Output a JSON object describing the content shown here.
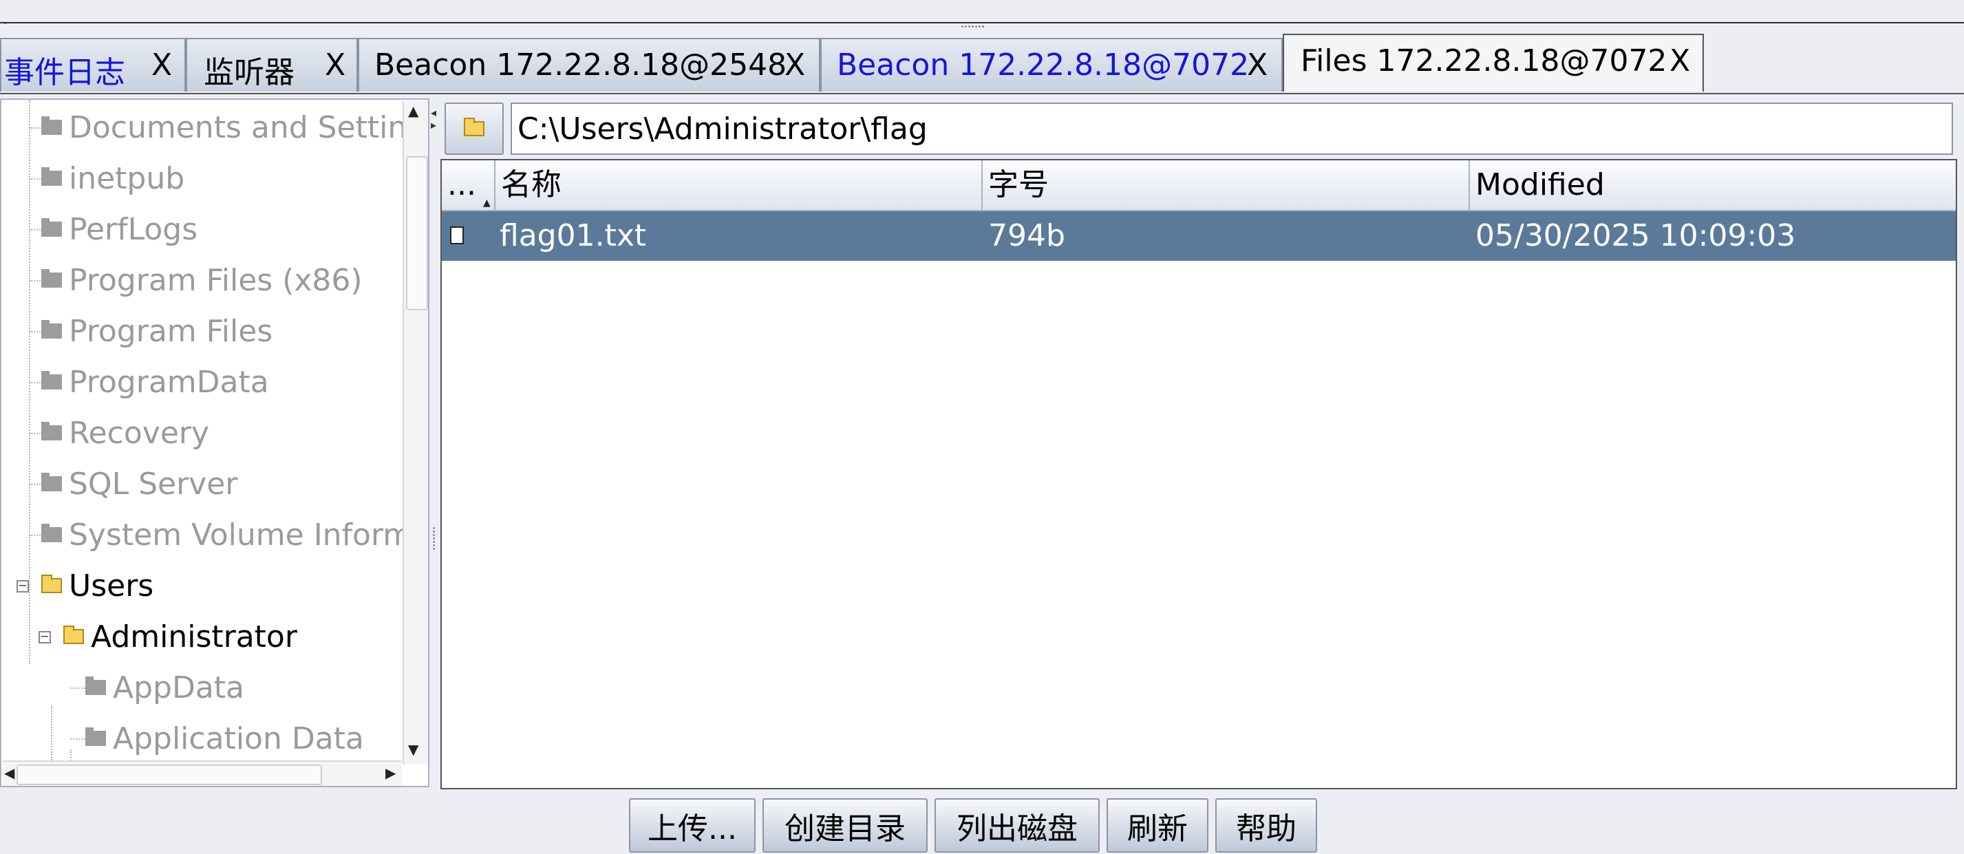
{
  "tabs": [
    {
      "label": "事件日志",
      "close": "X",
      "color": "#1414e0"
    },
    {
      "label": "监听器",
      "close": "X"
    },
    {
      "label": "Beacon 172.22.8.18@2548",
      "close": "X"
    },
    {
      "label": "Beacon 172.22.8.18@7072",
      "close": "X",
      "color": "#1414e0"
    },
    {
      "label": "Files 172.22.8.18@7072",
      "close": "X",
      "active": true
    }
  ],
  "tree": {
    "items": [
      {
        "label": "Documents and Settings",
        "expanded": false
      },
      {
        "label": "inetpub",
        "expanded": false
      },
      {
        "label": "PerfLogs",
        "expanded": false
      },
      {
        "label": "Program Files (x86)",
        "expanded": false
      },
      {
        "label": "Program Files",
        "expanded": false
      },
      {
        "label": "ProgramData",
        "expanded": false
      },
      {
        "label": "Recovery",
        "expanded": false
      },
      {
        "label": "SQL Server",
        "expanded": false
      },
      {
        "label": "System Volume Informat",
        "expanded": false
      },
      {
        "label": "Users",
        "expanded": true
      },
      {
        "label": "Administrator",
        "expanded": true
      },
      {
        "label": "AppData",
        "expanded": false
      },
      {
        "label": "Application Data",
        "expanded": false
      }
    ]
  },
  "path": {
    "value": "C:\\Users\\Administrator\\flag"
  },
  "table": {
    "columns": {
      "icon": "...",
      "name": "名称",
      "size": "字号",
      "modified": "Modified"
    },
    "rows": [
      {
        "name": "flag01.txt",
        "size": "794b",
        "modified": "05/30/2025 10:09:03",
        "selected": true
      }
    ]
  },
  "buttons": {
    "upload": "上传...",
    "mkdir": "创建目录",
    "list_drives": "列出磁盘",
    "refresh": "刷新",
    "help": "帮助"
  },
  "colors": {
    "selection": "#5b7a9a",
    "highlight_tab_text": "#1414e0",
    "disabled_text": "#9a9a9a"
  }
}
